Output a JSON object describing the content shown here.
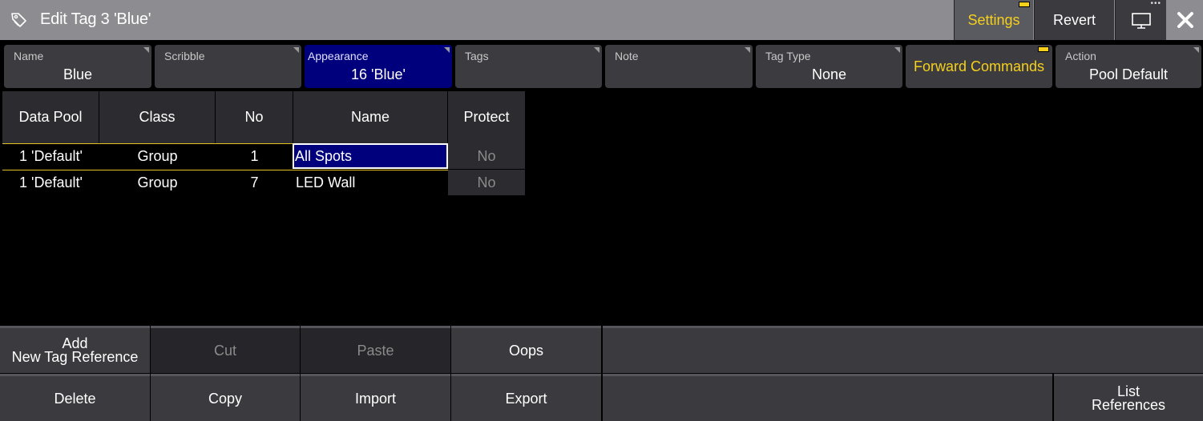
{
  "window": {
    "title": "Edit Tag 3 'Blue'",
    "settings_label": "Settings",
    "revert_label": "Revert",
    "accent_color": "#f5d01c",
    "selection_color": "#00007c"
  },
  "fields": {
    "name": {
      "label": "Name",
      "value": "Blue"
    },
    "scribble": {
      "label": "Scribble",
      "value": ""
    },
    "appearance": {
      "label": "Appearance",
      "value": "16 'Blue'"
    },
    "tags": {
      "label": "Tags",
      "value": ""
    },
    "note": {
      "label": "Note",
      "value": ""
    },
    "tag_type": {
      "label": "Tag Type",
      "value": "None"
    },
    "forward_commands": {
      "label": "Forward Commands"
    },
    "action": {
      "label": "Action",
      "value": "Pool Default"
    }
  },
  "table": {
    "columns": [
      "Data Pool",
      "Class",
      "No",
      "Name",
      "Protect"
    ],
    "rows": [
      {
        "data_pool": "1 'Default'",
        "class": "Group",
        "no": "1",
        "name": "All Spots",
        "protect": "No"
      },
      {
        "data_pool": "1 'Default'",
        "class": "Group",
        "no": "7",
        "name": "LED Wall",
        "protect": "No"
      }
    ]
  },
  "toolbar": {
    "add_line1": "Add",
    "add_line2": "New Tag Reference",
    "cut": "Cut",
    "paste": "Paste",
    "oops": "Oops",
    "delete": "Delete",
    "copy": "Copy",
    "import": "Import",
    "export": "Export",
    "list_line1": "List",
    "list_line2": "References"
  }
}
